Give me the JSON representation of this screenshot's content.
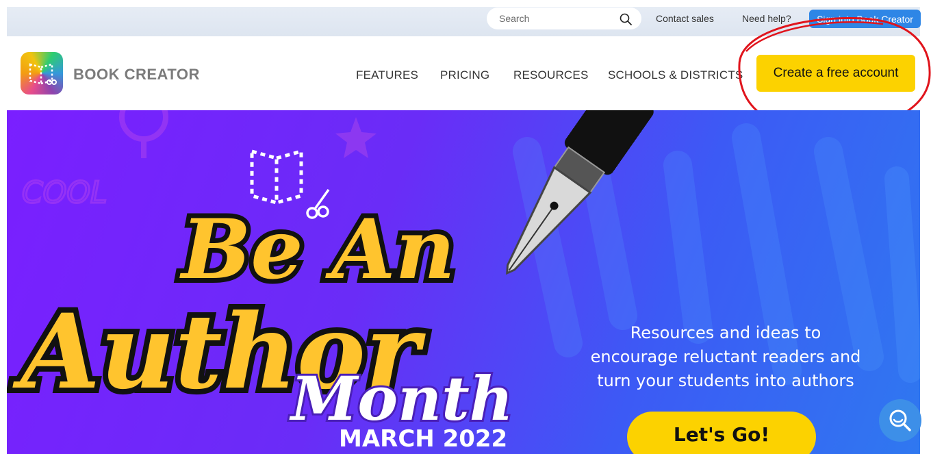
{
  "utility": {
    "search_placeholder": "Search",
    "contact_sales": "Contact sales",
    "need_help": "Need help?",
    "sign_in": "Sign into Book Creator"
  },
  "nav": {
    "brand": "BOOK CREATOR",
    "items": [
      "FEATURES",
      "PRICING",
      "RESOURCES",
      "SCHOOLS & DISTRICTS"
    ],
    "cta": "Create a free account"
  },
  "hero": {
    "title_line1": "Be An",
    "title_line2": "Author",
    "title_line3": "Month",
    "date": "MARCH 2022",
    "copy_line1": "Resources and ideas to",
    "copy_line2": "encourage reluctant readers and",
    "copy_line3": "turn your students into authors",
    "button": "Let's Go!",
    "doodle_text": "COOL"
  },
  "colors": {
    "accent_yellow": "#fcd200",
    "sign_in_blue": "#2e86e6",
    "annotation_red": "#e0141c",
    "hero_purple": "#7a1fff",
    "hero_blue": "#2f78f0"
  },
  "icons": {
    "search": "search-icon",
    "logo": "book-creator-logo-icon",
    "chat": "chat-search-icon",
    "pen": "fountain-pen-icon"
  }
}
